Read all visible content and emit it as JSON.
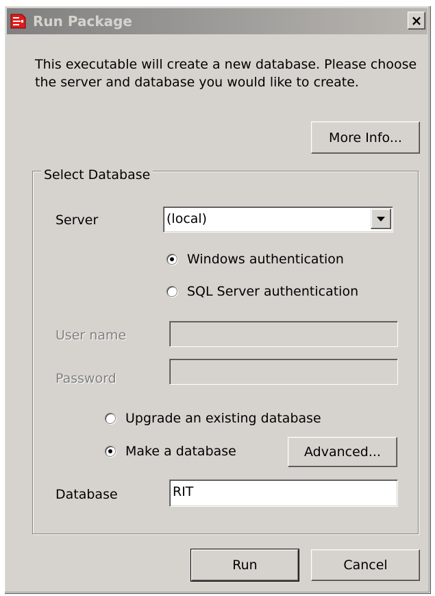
{
  "window": {
    "title": "Run Package",
    "close_glyph": "×",
    "app_icon": "package-icon",
    "close_icon": "close-icon"
  },
  "intro_text": "This executable will create a new database. Please choose the server and database you would like to create.",
  "buttons": {
    "more_info": "More Info...",
    "advanced": "Advanced...",
    "run": "Run",
    "cancel": "Cancel"
  },
  "group": {
    "legend": "Select Database"
  },
  "server": {
    "label": "Server",
    "selected_value": "(local)"
  },
  "auth": {
    "windows_label": "Windows authentication",
    "windows_checked": true,
    "sql_label": "SQL Server authentication",
    "sql_checked": false
  },
  "credentials": {
    "username_label": "User name",
    "username_value": "",
    "password_label": "Password",
    "password_value": "",
    "enabled": false
  },
  "mode": {
    "upgrade_label": "Upgrade an existing database",
    "upgrade_checked": false,
    "make_label": "Make a database",
    "make_checked": true
  },
  "database": {
    "label": "Database",
    "value": "RIT"
  },
  "colors": {
    "face": "#d6d3ce",
    "titlebar_start": "#808080",
    "titlebar_end": "#b9b6b1",
    "icon_red": "#e21b1b",
    "disabled_text": "#808080"
  }
}
